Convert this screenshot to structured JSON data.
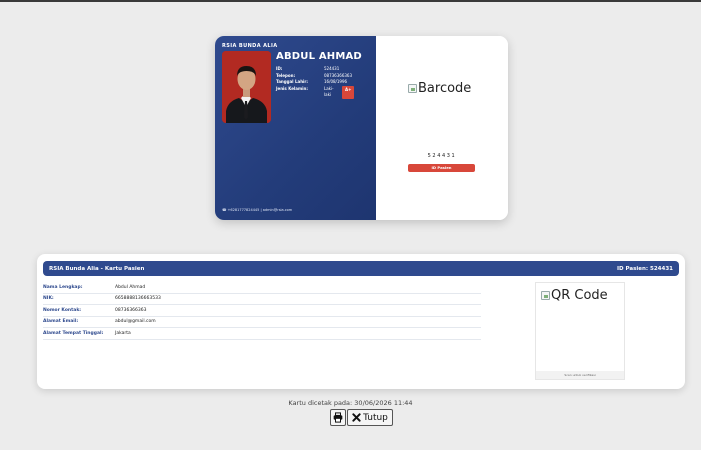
{
  "card": {
    "hospital": "RSIA BUNDA ALIA",
    "name": "ABDUL AHMAD",
    "fields": [
      {
        "label": "ID:",
        "value": "524431"
      },
      {
        "label": "Telepon:",
        "value": "08736366363"
      },
      {
        "label": "Tanggal Lahir:",
        "value": "16/08/1996"
      },
      {
        "label": "Jenis Kelamin:",
        "value": "Laki-laki"
      }
    ],
    "blood_type": "A+",
    "footer": "+6281777824445 | admin@rsia.com",
    "barcode_alt": "Barcode",
    "barcode_number": "524431",
    "id_label": "ID Pasien"
  },
  "panel": {
    "title": "RSIA Bunda Alia - Kartu Pasien",
    "patient_id": "ID Pasien: 524431",
    "rows": [
      {
        "label": "Nama Lengkap:",
        "value": "Abdul Ahmad"
      },
      {
        "label": "NIK:",
        "value": "6658888136663533"
      },
      {
        "label": "Nomor Kontak:",
        "value": "08736366363"
      },
      {
        "label": "Alamat Email:",
        "value": "abdul@gmail.com"
      },
      {
        "label": "Alamat Tempat Tinggal:",
        "value": "Jakarta"
      }
    ],
    "qr_alt": "QR Code",
    "qr_caption": "Scan untuk verifikasi"
  },
  "printed_at": "Kartu dicetak pada: 30/06/2026 11:44",
  "buttons": {
    "print_icon": "printer-icon",
    "close_icon": "x-icon",
    "close_label": "Tutup"
  },
  "colors": {
    "primary": "#2f4a8e",
    "accent": "#d8473a"
  }
}
